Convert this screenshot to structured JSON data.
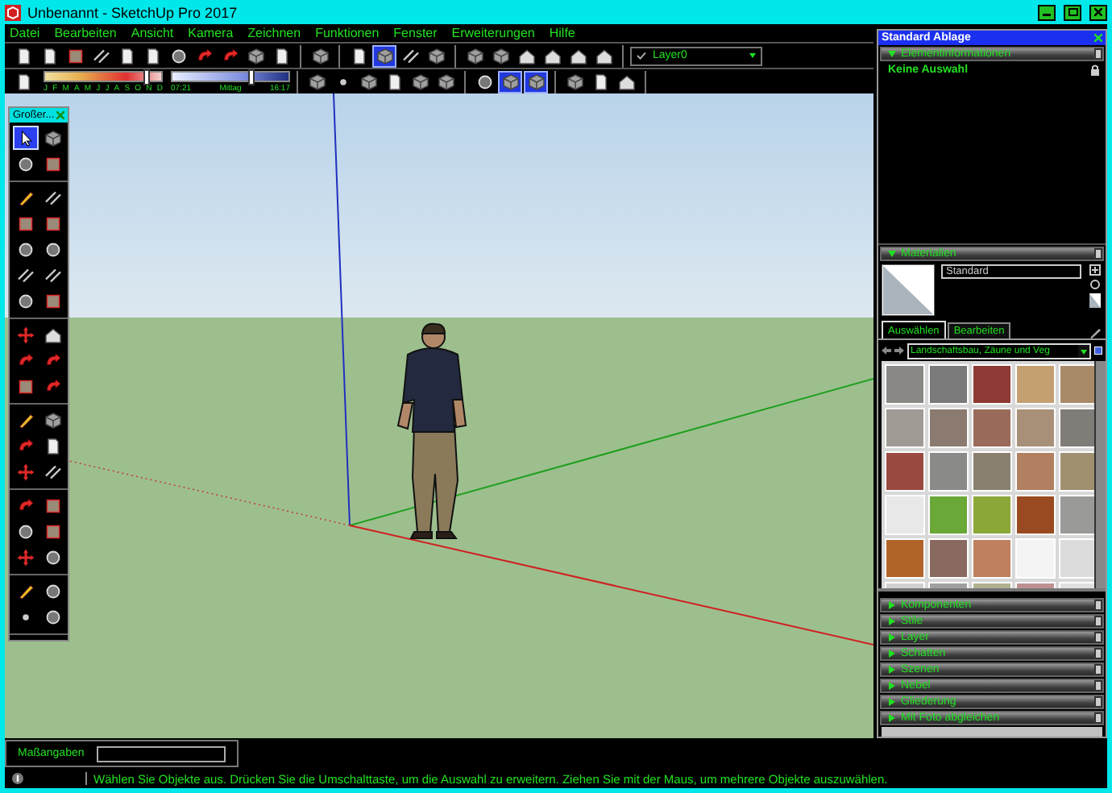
{
  "window": {
    "title": "Unbenannt - SketchUp Pro 2017"
  },
  "menu": [
    "Datei",
    "Bearbeiten",
    "Ansicht",
    "Kamera",
    "Zeichnen",
    "Funktionen",
    "Fenster",
    "Erweiterungen",
    "Hilfe"
  ],
  "toolbar_1": {
    "groups": [
      [
        {
          "kind": "page",
          "selected": false
        },
        {
          "kind": "page",
          "selected": false
        },
        {
          "kind": "square",
          "selected": false
        },
        {
          "kind": "lines",
          "selected": false
        },
        {
          "kind": "page",
          "selected": false
        },
        {
          "kind": "page",
          "selected": false
        },
        {
          "kind": "circle",
          "selected": false
        },
        {
          "kind": "arrow",
          "selected": false
        },
        {
          "kind": "arrow",
          "selected": false
        },
        {
          "kind": "cube",
          "selected": false
        },
        {
          "kind": "page",
          "selected": false
        }
      ],
      [
        {
          "kind": "cube",
          "selected": false
        }
      ],
      [
        {
          "kind": "page",
          "selected": false
        },
        {
          "kind": "cube",
          "selected": true
        },
        {
          "kind": "lines",
          "selected": false
        },
        {
          "kind": "cube",
          "selected": false
        }
      ],
      [
        {
          "kind": "cube",
          "selected": false
        },
        {
          "kind": "cube",
          "selected": false
        },
        {
          "kind": "house",
          "selected": false
        },
        {
          "kind": "house",
          "selected": false
        },
        {
          "kind": "house",
          "selected": false
        },
        {
          "kind": "house",
          "selected": false
        }
      ]
    ],
    "layer": "Layer0"
  },
  "toolbar_2": {
    "month_slider": {
      "level": 0.87,
      "labels": [
        "J",
        "F",
        "M",
        "A",
        "M",
        "J",
        "J",
        "A",
        "S",
        "O",
        "N",
        "D"
      ]
    },
    "time_slider": {
      "level": 0.68,
      "start": "07:21",
      "middle": "Mittag",
      "end": "16:17"
    },
    "groups": [
      [
        {
          "kind": "cube",
          "selected": false
        },
        {
          "kind": "dot",
          "selected": false
        },
        {
          "kind": "cube",
          "selected": false
        },
        {
          "kind": "page",
          "selected": false
        },
        {
          "kind": "cube",
          "selected": false
        },
        {
          "kind": "cube",
          "selected": false
        }
      ],
      [
        {
          "kind": "circle",
          "selected": false
        },
        {
          "kind": "cube",
          "selected": true
        },
        {
          "kind": "cube",
          "selected": true
        }
      ],
      [
        {
          "kind": "cube",
          "selected": false
        },
        {
          "kind": "page",
          "selected": false
        },
        {
          "kind": "house",
          "selected": false
        }
      ]
    ]
  },
  "toolbox": {
    "title": "Großer...",
    "groups": [
      [
        {
          "kind": "cursor",
          "selected": true
        },
        {
          "kind": "cube",
          "selected": false
        },
        {
          "kind": "circle",
          "selected": false
        },
        {
          "kind": "square",
          "selected": false
        }
      ],
      [
        {
          "kind": "pencil",
          "selected": false
        },
        {
          "kind": "lines",
          "selected": false
        },
        {
          "kind": "square",
          "selected": false
        },
        {
          "kind": "square",
          "selected": false
        },
        {
          "kind": "circle",
          "selected": false
        },
        {
          "kind": "circle",
          "selected": false
        },
        {
          "kind": "lines",
          "selected": false
        },
        {
          "kind": "lines",
          "selected": false
        },
        {
          "kind": "circle",
          "selected": false
        },
        {
          "kind": "square",
          "selected": false
        }
      ],
      [
        {
          "kind": "cross",
          "selected": false
        },
        {
          "kind": "house",
          "selected": false
        },
        {
          "kind": "arrow",
          "selected": false
        },
        {
          "kind": "arrow",
          "selected": false
        },
        {
          "kind": "square",
          "selected": false
        },
        {
          "kind": "arrow",
          "selected": false
        }
      ],
      [
        {
          "kind": "pencil",
          "selected": false
        },
        {
          "kind": "cube",
          "selected": false
        },
        {
          "kind": "arrow",
          "selected": false
        },
        {
          "kind": "page",
          "selected": false
        },
        {
          "kind": "cross",
          "selected": false
        },
        {
          "kind": "lines",
          "selected": false
        }
      ],
      [
        {
          "kind": "arrow",
          "selected": false
        },
        {
          "kind": "square",
          "selected": false
        },
        {
          "kind": "circle",
          "selected": false
        },
        {
          "kind": "square",
          "selected": false
        },
        {
          "kind": "cross",
          "selected": false
        },
        {
          "kind": "circle",
          "selected": false
        }
      ],
      [
        {
          "kind": "pencil",
          "selected": false
        },
        {
          "kind": "circle",
          "selected": false
        },
        {
          "kind": "dot",
          "selected": false
        },
        {
          "kind": "circle",
          "selected": false
        }
      ]
    ]
  },
  "tray": {
    "title": "Standard Ablage",
    "entity_info": {
      "title": "Elementinformationen",
      "expanded": true,
      "selection": "Keine Auswahl"
    },
    "materials": {
      "title": "Materialien",
      "expanded": true,
      "name": "Standard",
      "tabs": [
        {
          "label": "Auswählen",
          "selected": true
        },
        {
          "label": "Bearbeiten",
          "selected": false
        }
      ],
      "collection": "Landschaftsbau, Zäune und Veg",
      "swatches": [
        {
          "color": "#8a8884"
        },
        {
          "color": "#7a7a7a"
        },
        {
          "color": "#8e3a34"
        },
        {
          "color": "#c4a070"
        },
        {
          "color": "#a88a68"
        },
        {
          "color": "#a09a94"
        },
        {
          "color": "#8a7a70"
        },
        {
          "color": "#9a6a5a"
        },
        {
          "color": "#a89078"
        },
        {
          "color": "#807c78"
        },
        {
          "color": "#9a4a40"
        },
        {
          "color": "#8a8a88"
        },
        {
          "color": "#8a8070"
        },
        {
          "color": "#b08060"
        },
        {
          "color": "#a09070"
        },
        {
          "color": "#e8e8e8"
        },
        {
          "color": "#6aa838"
        },
        {
          "color": "#8aa838"
        },
        {
          "color": "#9a4a20"
        },
        {
          "color": "#9a9a98"
        },
        {
          "color": "#b0642a"
        },
        {
          "color": "#8a6a60"
        },
        {
          "color": "#c08060"
        },
        {
          "color": "#f4f4f4"
        },
        {
          "color": "#dcdcdc"
        },
        {
          "color": "#d0d0d0"
        },
        {
          "color": "#a0a0a0"
        },
        {
          "color": "#b0b090"
        },
        {
          "color": "#c09090"
        },
        {
          "color": "#e0e0e0"
        }
      ]
    },
    "panels": [
      {
        "title": "Komponenten",
        "expanded": false
      },
      {
        "title": "Stile",
        "expanded": false
      },
      {
        "title": "Layer",
        "expanded": false
      },
      {
        "title": "Schatten",
        "expanded": false
      },
      {
        "title": "Szenen",
        "expanded": false
      },
      {
        "title": "Nebel",
        "expanded": false
      },
      {
        "title": "Gliederung",
        "expanded": false
      },
      {
        "title": "Mit Foto abgleichen",
        "expanded": false
      }
    ]
  },
  "measurements": {
    "label": "Maßangaben"
  },
  "status_bar": {
    "message": "Wählen Sie Objekte aus. Drücken Sie die Umschalttaste, um die Auswahl zu erweitern. Ziehen Sie mit der Maus, um mehrere Objekte auszuwählen."
  }
}
